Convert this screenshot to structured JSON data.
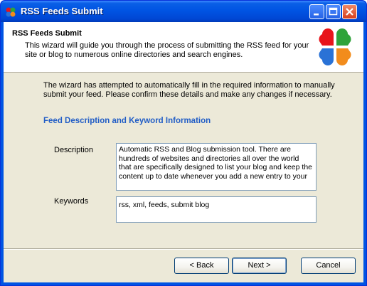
{
  "window": {
    "title": "RSS Feeds Submit",
    "icon": "rss-app-icon"
  },
  "header": {
    "title": "RSS Feeds Submit",
    "subtitle_line1": "This wizard will guide you through the process of submitting the RSS feed for your",
    "subtitle_line2": "site or blog to numerous online directories and search engines."
  },
  "body": {
    "intro_line1": "The wizard has attempted to automatically fill in the required information to manually",
    "intro_line2": "submit your feed. Please confirm these details and make any changes if necessary.",
    "section_title": "Feed Description and Keyword Information",
    "description_label": "Description",
    "description_lines": [
      "Automatic RSS and Blog submission tool. There are",
      "hundreds of websites and directories all over the world",
      "that are specifically designed to list your blog and keep the",
      "content up to date whenever you add a new entry to your"
    ],
    "keywords_label": "Keywords",
    "keywords_value": "rss, xml, feeds, submit blog"
  },
  "buttons": {
    "back": "< Back",
    "next": "Next >",
    "cancel": "Cancel"
  },
  "colors": {
    "section_title": "#215dc6",
    "titlebar": "#0054e3",
    "dialog_bg": "#ece9d8",
    "logo": [
      "#e8141b",
      "#2fa33a",
      "#2a72d6",
      "#f28c1c"
    ]
  }
}
